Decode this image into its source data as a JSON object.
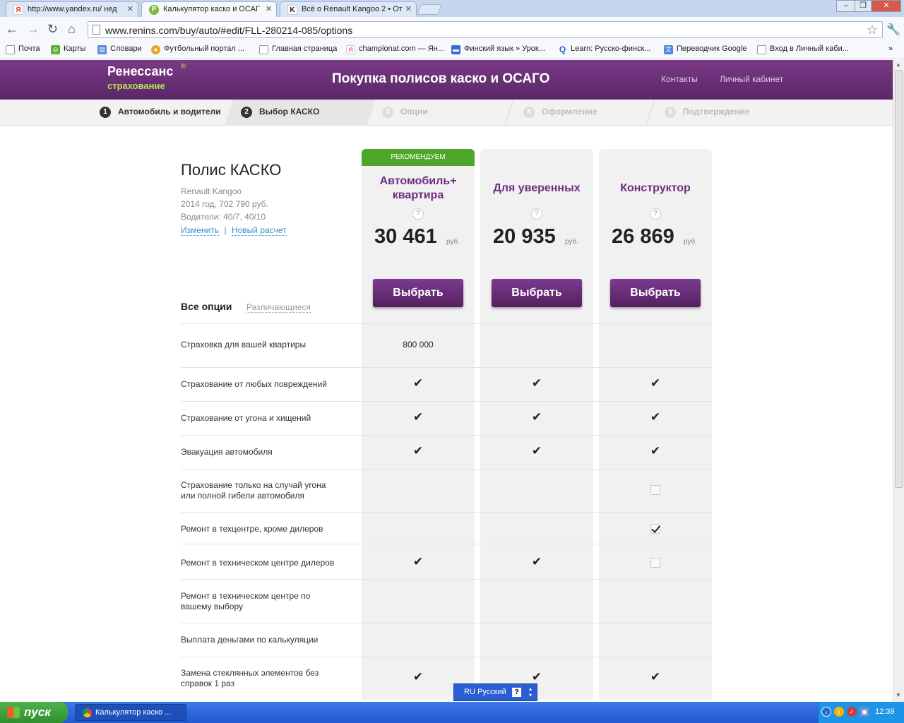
{
  "browser": {
    "tabs": [
      {
        "label": "http://www.yandex.ru/ нед",
        "icon": "yandex-icon"
      },
      {
        "label": "Калькулятор каско и ОСАГ",
        "icon": "renins-icon"
      },
      {
        "label": "Всё о Renault Kangoo 2 • От",
        "icon": "kangoo-icon"
      }
    ],
    "url": "www.renins.com/buy/auto/#edit/FLL-280214-085/options",
    "bookmarks": [
      "Почта",
      "Карты",
      "Словари",
      "Футбольный портал ...",
      "Главная страница",
      "championat.com — Ян...",
      "Финский язык » Урок...",
      "Learn: Русско-финск...",
      "Переводчик Google",
      "Вход в Личный каби..."
    ]
  },
  "site": {
    "logo_line1": "Ренессанс",
    "logo_line2": "страхование",
    "logo_mark": "®",
    "title": "Покупка полисов каско и ОСАГО",
    "nav": [
      "Контакты",
      "Личный кабинет"
    ]
  },
  "steps": [
    {
      "num": "1",
      "label": "Автомобиль и водители"
    },
    {
      "num": "2",
      "label": "Выбор КАСКО"
    },
    {
      "num": "3",
      "label": "Опции"
    },
    {
      "num": "4",
      "label": "Оформление"
    },
    {
      "num": "5",
      "label": "Подтверждение"
    }
  ],
  "policy": {
    "title": "Полис КАСКО",
    "car": "Renault Kangoo",
    "year_price": "2014 год, 702 790 руб.",
    "drivers": "Водители: 40/7, 40/10",
    "edit_link": "Изменить",
    "separator": "|",
    "new_link": "Новый расчет"
  },
  "filters": {
    "all": "Все опции",
    "diff": "Различающиеся"
  },
  "plans": [
    {
      "badge": "РЕКОМЕНДУЕМ",
      "name_line1": "Автомобиль+",
      "name_line2": "квартира",
      "help": "?",
      "price": "30 461",
      "currency": "руб.",
      "button": "Выбрать"
    },
    {
      "badge": "",
      "name_line1": "Для уверенных",
      "name_line2": "",
      "help": "?",
      "price": "20 935",
      "currency": "руб.",
      "button": "Выбрать"
    },
    {
      "badge": "",
      "name_line1": "Конструктор",
      "name_line2": "",
      "help": "?",
      "price": "26 869",
      "currency": "руб.",
      "button": "Выбрать"
    }
  ],
  "rows": [
    {
      "label": "Страховка для вашей квартиры",
      "cells": [
        "800 000",
        "",
        ""
      ]
    },
    {
      "label": "Страхование от любых повреждений",
      "cells": [
        "check",
        "check",
        "check"
      ]
    },
    {
      "label": "Страхование от угона и хищений",
      "cells": [
        "check",
        "check",
        "check"
      ]
    },
    {
      "label": "Эвакуация автомобиля",
      "cells": [
        "check",
        "check",
        "check"
      ]
    },
    {
      "label": "Страхование только на случай угона или полной гибели автомобиля",
      "cells": [
        "",
        "",
        "box-off"
      ]
    },
    {
      "label": "Ремонт в техцентре, кроме дилеров",
      "cells": [
        "",
        "",
        "box-on"
      ]
    },
    {
      "label": "Ремонт в техническом центре дилеров",
      "cells": [
        "check",
        "check",
        "box-off"
      ]
    },
    {
      "label": "Ремонт в техническом центре по вашему выбору",
      "cells": [
        "",
        "",
        ""
      ]
    },
    {
      "label": "Выплата деньгами по калькуляции",
      "cells": [
        "",
        "",
        ""
      ]
    },
    {
      "label": "Замена стеклянных элементов без справок 1 раз",
      "cells": [
        "check",
        "check",
        "check"
      ]
    }
  ],
  "check_glyph": "✔",
  "langbar": {
    "label": "RU Русский",
    "help": "?"
  },
  "taskbar": {
    "start": "пуск",
    "item": "Калькулятор каско ...",
    "clock": "12:39"
  },
  "colors": {
    "brand": "#6e2e7e",
    "accent": "#4ea72a",
    "button": "#5e2669"
  }
}
